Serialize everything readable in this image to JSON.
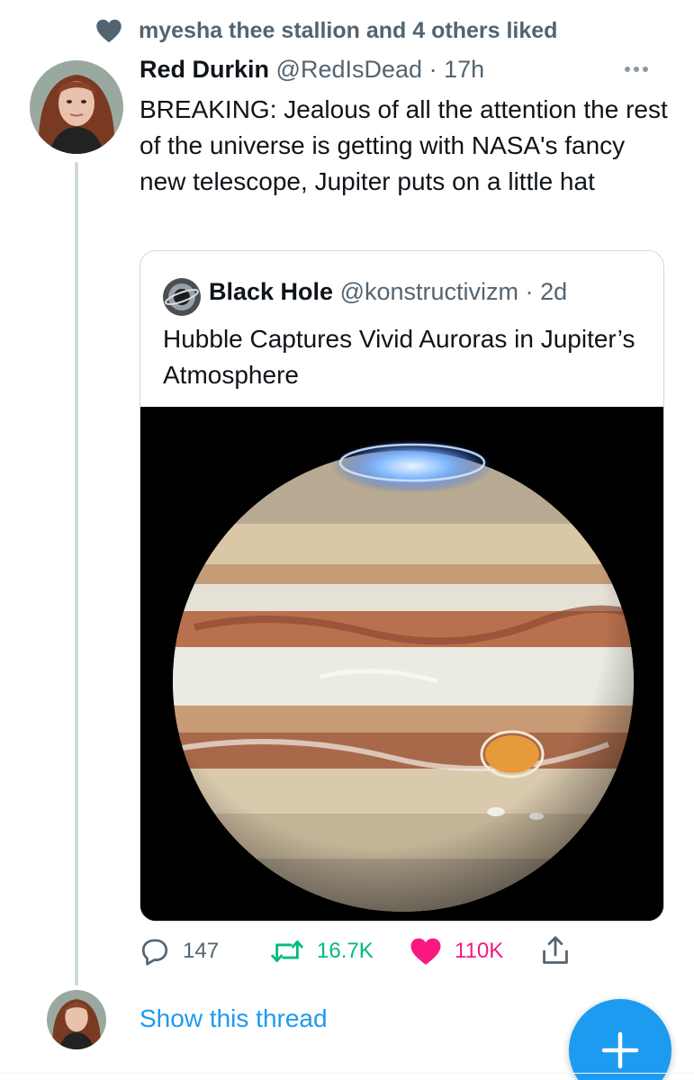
{
  "social_context": {
    "liked_text": "myesha thee stallion and 4 others liked",
    "icon": "heart-icon"
  },
  "tweet": {
    "author_name": "Red Durkin",
    "author_handle": "@RedIsDead",
    "separator": "·",
    "time": "17h",
    "text": "BREAKING: Jealous of all the attention the rest of the universe is getting with NASA's fancy new telescope, Jupiter puts on a little hat",
    "more_icon": "more-horizontal-icon"
  },
  "quoted_tweet": {
    "author_name": "Black Hole",
    "author_handle": "@konstructivizm",
    "separator": "·",
    "time": "2d",
    "text": "Hubble Captures Vivid Auroras in Jupiter’s Atmosphere",
    "image": "jupiter-photo"
  },
  "actions": {
    "reply_count": "147",
    "retweet_count": "16.7K",
    "like_count": "110K",
    "reply_icon": "reply-icon",
    "retweet_icon": "retweet-icon",
    "like_icon": "heart-filled-icon",
    "share_icon": "share-icon"
  },
  "show_thread": "Show this thread",
  "compose_button": {
    "icon": "plus-icon"
  },
  "colors": {
    "accent": "#1d9bf0",
    "like": "#f91880",
    "retweet": "#00ba7c",
    "secondary_text": "#536471",
    "border": "#cfd9de"
  }
}
